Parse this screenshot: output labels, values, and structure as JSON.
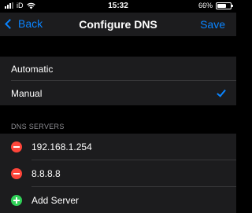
{
  "status": {
    "carrier": "iD",
    "time": "15:32",
    "battery_text": "66%",
    "battery_level": 0.66
  },
  "nav": {
    "back_label": "Back",
    "title": "Configure DNS",
    "save_label": "Save"
  },
  "mode": {
    "options": [
      {
        "label": "Automatic",
        "selected": false
      },
      {
        "label": "Manual",
        "selected": true
      }
    ]
  },
  "dns_servers": {
    "header": "DNS SERVERS",
    "servers": [
      "192.168.1.254",
      "8.8.8.8"
    ],
    "add_label": "Add Server"
  },
  "colors": {
    "accent": "#0a84ff",
    "delete": "#ff453a",
    "add": "#30d158",
    "background": "#000000",
    "cell": "#1c1c1e"
  },
  "icons": [
    "signal-icon",
    "wifi-icon",
    "battery-icon",
    "chevron-left-icon",
    "checkmark-icon",
    "minus-circle-icon",
    "plus-circle-icon"
  ]
}
